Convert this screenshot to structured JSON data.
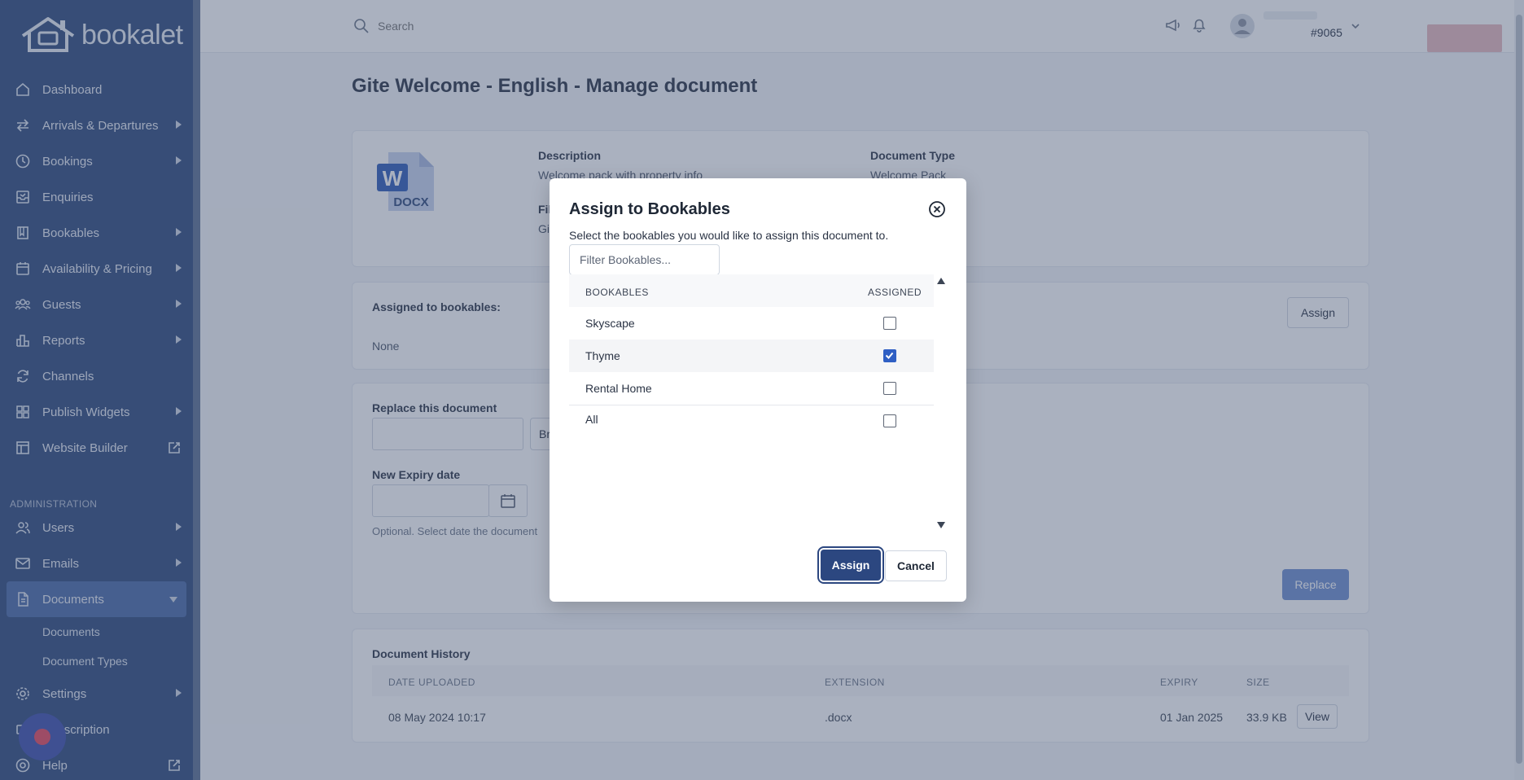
{
  "brand": {
    "name": "bookalet"
  },
  "sidebar": {
    "items": [
      {
        "label": "Dashboard",
        "icon": "home-icon"
      },
      {
        "label": "Arrivals & Departures",
        "icon": "swap-arrows-icon"
      },
      {
        "label": "Bookings",
        "icon": "clock-icon"
      },
      {
        "label": "Enquiries",
        "icon": "inbox-icon"
      },
      {
        "label": "Bookables",
        "icon": "book-icon"
      },
      {
        "label": "Availability & Pricing",
        "icon": "calendar-icon"
      },
      {
        "label": "Guests",
        "icon": "people-icon"
      },
      {
        "label": "Reports",
        "icon": "bar-chart-icon"
      },
      {
        "label": "Channels",
        "icon": "sync-icon"
      },
      {
        "label": "Publish Widgets",
        "icon": "widgets-icon"
      },
      {
        "label": "Website Builder",
        "icon": "layout-icon"
      }
    ],
    "admin_heading": "ADMINISTRATION",
    "admin_items": [
      {
        "label": "Users",
        "icon": "users-icon"
      },
      {
        "label": "Emails",
        "icon": "mail-icon"
      },
      {
        "label": "Documents",
        "icon": "document-icon"
      }
    ],
    "documents_sub": [
      "Documents",
      "Document Types"
    ],
    "bottom_items": [
      {
        "label": "Settings",
        "icon": "gear-icon"
      },
      {
        "label": "Subscription",
        "icon": "subscription-icon"
      },
      {
        "label": "Help",
        "icon": "help-icon"
      }
    ]
  },
  "topbar": {
    "search_placeholder": "Search",
    "user_id": "#9065"
  },
  "page": {
    "title": "Gite Welcome - English - Manage document",
    "file_badge": "DOCX",
    "description_label": "Description",
    "description_value": "Welcome pack with property info",
    "document_type_label": "Document Type",
    "document_type_value": "Welcome Pack",
    "file_label_partial": "Fil",
    "file_value_partial": "Gi",
    "assigned_label": "Assigned to bookables:",
    "assigned_value": "None",
    "assign_button": "Assign",
    "replace_label": "Replace this document",
    "browse_partial": "Br",
    "expiry_label": "New Expiry date",
    "expiry_hint": "Optional. Select date the document",
    "replace_button": "Replace",
    "history_label": "Document History",
    "history_headers": [
      "DATE UPLOADED",
      "EXTENSION",
      "EXPIRY",
      "SIZE"
    ],
    "history_row": {
      "date": "08 May 2024 10:17",
      "extension": ".docx",
      "expiry": "01 Jan 2025",
      "size": "33.9 KB",
      "action": "View"
    }
  },
  "modal": {
    "title": "Assign to Bookables",
    "description": "Select the bookables you would like to assign this document to.",
    "filter_placeholder": "Filter Bookables...",
    "col_bookables": "BOOKABLES",
    "col_assigned": "ASSIGNED",
    "rows": [
      {
        "name": "Skyscape",
        "checked": false
      },
      {
        "name": "Thyme",
        "checked": true
      },
      {
        "name": "Rental Home",
        "checked": false
      },
      {
        "name": "All",
        "checked": false
      }
    ],
    "assign_label": "Assign",
    "cancel_label": "Cancel"
  },
  "colors": {
    "sidebar_bg": "#2e4a7d",
    "primary": "#2c4780",
    "checkbox_checked": "#2f5fc4",
    "chat_dot": "#e8485d"
  }
}
